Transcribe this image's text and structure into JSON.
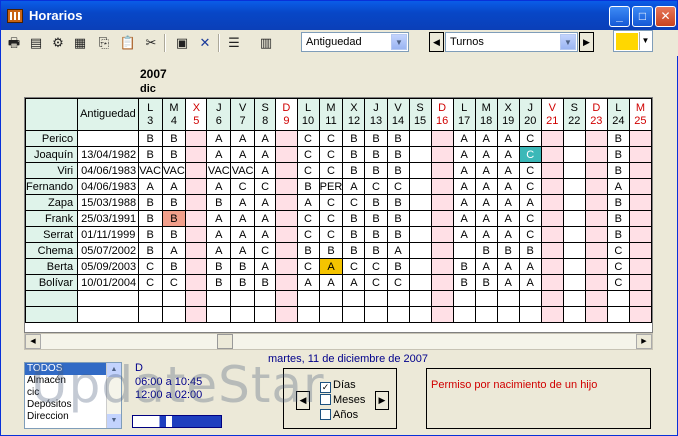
{
  "window": {
    "title": "Horarios"
  },
  "toolbar": {
    "icons": [
      "printer-icon",
      "print-preview-icon",
      "settings-icon",
      "calendar-view-icon",
      "copy-icon",
      "paste-icon",
      "cut-icon",
      "grid-icon",
      "delete-icon",
      "notes-icon",
      "calendar-icon"
    ],
    "sort_value": "Antiguedad",
    "shift_value": "Turnos",
    "color": "#ffd700"
  },
  "grid": {
    "year": "2007",
    "month": "dic",
    "date_header": "Antiguedad",
    "days": [
      {
        "l": "L",
        "n": "3",
        "we": false
      },
      {
        "l": "M",
        "n": "4",
        "we": false
      },
      {
        "l": "X",
        "n": "5",
        "we": true
      },
      {
        "l": "J",
        "n": "6",
        "we": false
      },
      {
        "l": "V",
        "n": "7",
        "we": false
      },
      {
        "l": "S",
        "n": "8",
        "we": false
      },
      {
        "l": "D",
        "n": "9",
        "we": true
      },
      {
        "l": "L",
        "n": "10",
        "we": false
      },
      {
        "l": "M",
        "n": "11",
        "we": false
      },
      {
        "l": "X",
        "n": "12",
        "we": false
      },
      {
        "l": "J",
        "n": "13",
        "we": false
      },
      {
        "l": "V",
        "n": "14",
        "we": false
      },
      {
        "l": "S",
        "n": "15",
        "we": false
      },
      {
        "l": "D",
        "n": "16",
        "we": true
      },
      {
        "l": "L",
        "n": "17",
        "we": false
      },
      {
        "l": "M",
        "n": "18",
        "we": false
      },
      {
        "l": "X",
        "n": "19",
        "we": false
      },
      {
        "l": "J",
        "n": "20",
        "we": false
      },
      {
        "l": "V",
        "n": "21",
        "we": true
      },
      {
        "l": "S",
        "n": "22",
        "we": false
      },
      {
        "l": "D",
        "n": "23",
        "we": true
      },
      {
        "l": "L",
        "n": "24",
        "we": false
      },
      {
        "l": "M",
        "n": "25",
        "we": true
      }
    ],
    "rows": [
      {
        "name": "Perico",
        "date": "",
        "cells": [
          "B",
          "B",
          "",
          "A",
          "A",
          "A",
          "",
          "C",
          "C",
          "B",
          "B",
          "B",
          "",
          "",
          "A",
          "A",
          "A",
          "C",
          "",
          "",
          "",
          "B",
          ""
        ]
      },
      {
        "name": "Joaquín",
        "date": "13/04/1982",
        "cells": [
          "B",
          "B",
          "",
          "A",
          "A",
          "A",
          "",
          "C",
          "C",
          "B",
          "B",
          "B",
          "",
          "",
          "A",
          "A",
          "A",
          "C",
          "",
          "",
          "",
          "B",
          ""
        ]
      },
      {
        "name": "Viri",
        "date": "04/06/1983",
        "cells": [
          "VAC",
          "VAC",
          "",
          "VAC",
          "VAC",
          "A",
          "",
          "C",
          "C",
          "B",
          "B",
          "B",
          "",
          "",
          "A",
          "A",
          "A",
          "C",
          "",
          "",
          "",
          "B",
          ""
        ]
      },
      {
        "name": "Fernando",
        "date": "04/06/1983",
        "cells": [
          "A",
          "A",
          "",
          "A",
          "C",
          "C",
          "",
          "B",
          "PER",
          "A",
          "C",
          "C",
          "",
          "",
          "A",
          "A",
          "A",
          "C",
          "",
          "",
          "",
          "A",
          ""
        ]
      },
      {
        "name": "Zapa",
        "date": "15/03/1988",
        "cells": [
          "B",
          "B",
          "",
          "B",
          "A",
          "A",
          "",
          "A",
          "C",
          "C",
          "B",
          "B",
          "",
          "",
          "A",
          "A",
          "A",
          "A",
          "",
          "",
          "",
          "B",
          ""
        ]
      },
      {
        "name": "Frank",
        "date": "25/03/1991",
        "cells": [
          "B",
          "B",
          "",
          "A",
          "A",
          "A",
          "",
          "C",
          "C",
          "B",
          "B",
          "B",
          "",
          "",
          "A",
          "A",
          "A",
          "C",
          "",
          "",
          "",
          "B",
          ""
        ]
      },
      {
        "name": "Serrat",
        "date": "01/11/1999",
        "cells": [
          "B",
          "B",
          "",
          "A",
          "A",
          "A",
          "",
          "C",
          "C",
          "B",
          "B",
          "B",
          "",
          "",
          "A",
          "A",
          "A",
          "C",
          "",
          "",
          "",
          "B",
          ""
        ]
      },
      {
        "name": "Chema",
        "date": "05/07/2002",
        "cells": [
          "B",
          "A",
          "",
          "A",
          "A",
          "C",
          "",
          "B",
          "B",
          "B",
          "B",
          "A",
          "",
          "",
          "",
          "B",
          "B",
          "B",
          "",
          "",
          "",
          "C",
          ""
        ]
      },
      {
        "name": "Berta",
        "date": "05/09/2003",
        "cells": [
          "C",
          "B",
          "",
          "B",
          "B",
          "A",
          "",
          "C",
          "A",
          "C",
          "C",
          "B",
          "",
          "",
          "B",
          "A",
          "A",
          "A",
          "",
          "",
          "",
          "C",
          ""
        ]
      },
      {
        "name": "Bolívar",
        "date": "10/01/2004",
        "cells": [
          "C",
          "C",
          "",
          "B",
          "B",
          "B",
          "",
          "A",
          "A",
          "A",
          "C",
          "C",
          "",
          "",
          "B",
          "B",
          "A",
          "A",
          "",
          "",
          "",
          "C",
          ""
        ]
      }
    ]
  },
  "bottom": {
    "groups": [
      "TODOS",
      "Almacén",
      "cic",
      "Depósitos",
      "Direccion"
    ],
    "schedule_code": "D",
    "schedule_lines": [
      "06:00 a 10:45",
      "12:00 a 02:00"
    ],
    "date_label": "martes, 11 de diciembre de 2007",
    "period": {
      "dias": "Días",
      "meses": "Meses",
      "anios": "Años"
    },
    "note": "Permiso por nacimiento de un hijo",
    "watermark": "UpdateStar"
  }
}
